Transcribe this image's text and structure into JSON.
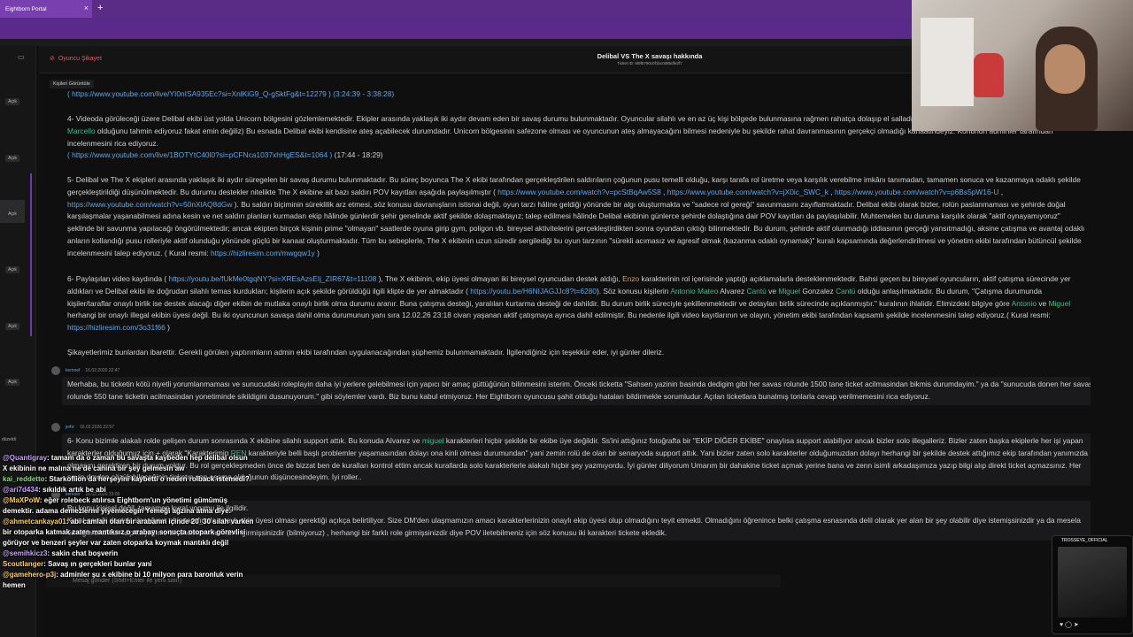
{
  "browser": {
    "tab_title": "Eightborn Portal",
    "tab_close": "×",
    "new_tab": "+"
  },
  "rail": {
    "items": [
      "Açık",
      "Açık",
      "Açık",
      "Açık",
      "Açık",
      "Açık"
    ],
    "footer": "düzeldi"
  },
  "ticket": {
    "back_label": "Oyuncu Şikayet",
    "title": "Delibal VS The X savaşı hakkında",
    "id": "Ticket ID: 6f9f5790c0f1bc0d8bdfe2f7",
    "section_label": "Kişileri Görüntüle"
  },
  "content": {
    "p_link_top": "( https://www.youtube.com/live/YI0nISA935Ec?si=XnlKiG9_Q-gSktFg&t=12279 ) (3:24:39 - 3:38:28)",
    "p4": "4- Videoda görüleceği üzere Delibal ekibi üst yolda Unicorn bölgesini gözlemlemektedir. Ekipler arasında yaklaşık iki aydır devam eden bir savaş durumu bulunmaktadır. Oyuncular silahlı ve en az üç kişi bölgede bulunmasına rağmen rahatça dolaşıp el salladığı görülmektedir.(Anlayabildiğimiz kadarıyla",
    "p4_name": "Marcello",
    "p4b": "olduğunu tahmin ediyoruz fakat emin değiliz) Bu esnada Delibal ekibi kendisine ateş açabilecek durumdadır. Unicorn bölgesinin safezone olması ve oyuncunun ateş almayacağını bilmesi nedeniyle bu şekilde rahat davranmasının gerçekçi olmadığı kanaatindeyiz. Konunun adminler tarafından incelenmesini rica ediyoruz.",
    "p4_link": "( https://www.youtube.com/live/1BOTYtC40l0?si=pCFNca1037xhHgES&t=1064 )",
    "p4_time": "(17:44 - 18:29)",
    "p5": "5- Delibal ve The X ekipleri arasında yaklaşık iki aydır süregelen bir savaş durumu bulunmaktadır. Bu süreç boyunca The X ekibi tarafından gerçekleştirilen saldırıların çoğunun pusu temelli olduğu, karşı tarafa rol üretme veya karşılık verebilme imkânı tanımadan, tamamen sonuca ve kazanmaya odaklı şekilde gerçekleştirildiği düşünülmektedir. Bu durumu destekler nitelikte The X ekibine ait bazı saldırı POV kayıtları aşağıda paylaşılmıştır (",
    "p5_link1": "https://www.youtube.com/watch?v=pcStBqAw5S8",
    "p5_link2": "https://www.youtube.com/watch?v=jX0ic_SWC_k",
    "p5_link3": "https://www.youtube.com/watch?v=p6Bs5pW16-U",
    "p5_link4": "https://www.youtube.com/watch?v=50nXlAQ8dGw",
    "p5b": "). Bu saldırı biçiminin süreklilik arz etmesi, söz konusu davranışların istisnai değil, oyun tarzı hâline geldiği yönünde bir algı oluşturmakta ve \"sadece rol gereği\" savunmasını zayıflatmaktadır. Delibal ekibi olarak bizler, rolün paslanmaması ve şehirde doğal karşılaşmalar yaşanabilmesi adına kesin ve net saldırı planları kurmadan ekip hâlinde günlerdir şehir genelinde aktif şekilde dolaşmaktayız; talep edilmesi hâlinde Delibal ekibinin günlerce şehirde dolaştığına dair POV kayıtları da paylaşılabilir. Muhtemelen bu duruma karşılık olarak \"aktif oynayamıyoruz\" şeklinde bir savunma yapılacağı öngörülmektedir; ancak ekipten birçok kişinin prime \"olmayan\" saatlerde oyuna girip gym, poligon vb. bireysel aktivitelerini gerçekleştirdikten sonra oyundan çıktığı bilinmektedir. Bu durum, şehirde aktif olunmadığı iddiasının gerçeği yansıtmadığı, aksine çatışma ve avantaj odaklı anların kollandığı pusu rolleriyle aktif olunduğu yönünde güçlü bir kanaat oluşturmaktadır. Tüm bu sebeplerle, The X ekibinin uzun süredir sergilediği bu oyun tarzının \"sürekli acımasız ve agresif olmak (kazanma odaklı oynamak)\" kuralı kapsamında değerlendirilmesi ve yönetim ekibi tarafından bütüncül şekilde incelenmesini talep ediyoruz. ( Kural resmi:",
    "p5_rule": "https://hizliresim.com/mwgqw1y",
    "p6a": "6- Paylaşılan video kaydında (",
    "p6_link1": "https://youtu.be/fUkMe0tgqNY?si=XREsAzsEIj_ZIR67&t=11108",
    "p6b": "), The X ekibinin, ekip üyesi olmayan iki bireysel oyuncudan destek aldığı,",
    "p6_enzo": "Enzo",
    "p6c": "karakterinin rol içerisinde yaptığı açıklamalarla desteklenmektedir. Bahsi geçen bu bireysel oyuncuların, aktif çatışma sürecinde yer aldıkları ve Delibal ekibi ile doğrudan silahlı temas kurdukları; kişilerin açık şekilde görüldüğü ilgili klipte de yer almaktadır (",
    "p6_link2": "https://youtu.be/H6NIJAGJJc8?t=6280",
    "p6d": "). Söz konusu kişilerin",
    "p6_n1": "Antonio Mateo",
    "p6_alv": "Alvarez",
    "p6_n2": "Cantú",
    "p6_ve": "ve",
    "p6_n3": "Miguel",
    "p6_gon": "Gonzalez",
    "p6_n4": "Cantú",
    "p6e": "olduğu anlaşılmaktadır. Bu durum, \"Çatışma durumunda kişiler/taraflar onaylı birlik ise destek alacağı diğer ekibin de mutlaka onaylı birlik olma durumu aranır. Buna çatışma desteği, yaralıları kurtarma desteği de dahildir. Bu durum birlik süreciyle şekillenmektedir ve detayları birlik sürecinde açıklanmıştır.\" kuralının ihlalidir. Elimizdeki bilgiye göre",
    "p6_n5": "Antonio",
    "p6_ve2": "ve",
    "p6_n6": "Miguel",
    "p6f": "herhangi bir onaylı illegal ekibin üyesi değil. Bu iki oyuncunun savaşa dahil olma durumunun yanı sıra 12.02.26 23:18 civarı yaşanan aktif çatışmaya ayrıca dahil edilmiştir. Bu nedenle ilgili video kayıtlarının ve olayın, yönetim ekibi tarafından kapsamlı şekilde incelenmesini talep ediyoruz.( Kural resmi:",
    "p6_rule": "https://hizliresim.com/3o31f66",
    "p6_end": ")",
    "closing": "Şikayetlerimiz bunlardan ibarettir. Gerekli görülen yaptırımların admin ekibi tarafından uygulanacağından şüphemiz bulunmamaktadır. İlgilendiğiniz için teşekkür eder, iyi günler dileriz.",
    "msg1_user": "kemoef",
    "msg1_time": "16.02.2026 22:47",
    "msg1": "Merhaba, bu ticketin kötü niyetli yorumlanmaması ve sunucudaki roleplayin daha iyi yerlere gelebilmesi için yapıcı bir amaç güttüğünün bilinmesini isterim. Önceki ticketta \"Sahsen yazinin basinda dedigim gibi her savas rolunde 1500 tane ticket acilmasindan bikmis durumdayim.\" ya da \"sunucuda donen her savas rolunde 550 tane ticketin acilmasindan yonetiminde sikildigini dusunuyorum.\" gibi söylemler vardı. Biz bunu kabul etmiyoruz. Her Eightborn oyuncusu şahit olduğu hataları bildirmekle sorumludur. Açılan ticketlara bunalmış tonlarla cevap verilmemesini rica ediyoruz.",
    "msg2_user": "je4rr",
    "msg2_time": "16.02.2026 22:57",
    "msg2a": "6- Konu bizimle alakalı rolde gelişen durum sonrasında X ekibine silahlı support attık. Bu konuda Alvarez ve",
    "msg2_n1": "miguel",
    "msg2b": "karakterleri hiçbir şekilde bir ekibe üye değildir. Ss'ini attığınız fotoğrafta bir \"EKİP DİĞER EKİBE\" onaylısa support atabiliyor ancak bizler solo illegalleriz. Bizler zaten başka ekiplerle her işi yapan karakterler olduğumuz için + olarak \"Karakterimin",
    "msg2_n2": "REN",
    "msg2c": "karakteriyle belli başlı problemler yaşamasından dolayı ona kinli olması durumundan\" yani zemin rolü de olan bir senaryoda support attık. Yani bizler zaten solo karakterler olduğumuzdan dolayı herhangi bir şekilde destek attığımız ekip tarafından yanımızda olmasını gerektiren bir durum yoktur. Bu rol gerçekleşmeden önce de bizzat ben de kuralları kontrol ettim ancak kurallarda solo karakterlerle alakalı hiçbir şey yazmıyordu. İyi günler diliyorum Umarım bir dahakine ticket açmak yerine bana ve zenn isimli arkadaşımıza yazıp bilgi alıp direkt ticket açmazsınız. Her şeyin dmden çözülebileceğinin ticketın son aşama olduğunun düşüncesindeyim. İyi roller..",
    "msg3_user": "kemoef",
    "msg3_time": "16.02.2026 23:05",
    "msg3a": "Bu konu kişisel değil, tamamen kural yorumu ile ilgilidir.",
    "msg3b": "Kural gereği destek alacağınız ekip tarafın da onaylı ekip üyesi olması gerektiği açıkça belirtiliyor. Size DM'den ulaşmamızın amacı karakterlerinizin onaylı ekip üyesi olup olmadığını teyit etmekti. Olmadığını öğrenince belki çatışma esnasında delil olarak yer alan bir şey olabilir diye istemişsinizdir ya da mesela örneğin silahları alıp kaçtığınız bir dolandırma rolüne girmişsinizdir (bilmiyoruz) , herhangi bir farklı role girmişsinizdir diye POV iletebilmeniz için söz konusu iki karakteri tickete ekledik."
  },
  "input": {
    "placeholder": "Mesaj gönder (Shift+Enter ile yeni satır)"
  },
  "chat": [
    {
      "user": "@Quantigray",
      "text": ": tamam da o zaman bu savaşta kaybeden hep delibal olsun"
    },
    {
      "user": "",
      "text": "X ekibinin ne malına ne de canına bir şey gelmesin aw"
    },
    {
      "user": "kai_reddetto",
      "text": ": Starkoflion da herşeyini kaybetti o neden rolback istemedi?"
    },
    {
      "user": "@ari7d434",
      "text": ": sıkıldık artık be abi"
    },
    {
      "user": "@MaXPoW",
      "text": ": eğer rolebeck atılırsa Eightborn'un yönetimi gümümüş demektir. adama demezlermi yiyemecegin Yemeği ağzına atma diye."
    },
    {
      "user": "@ahmetcankaya01",
      "text": ": abi camları olan bir arabanın içinde 20_30 silah varken bir otoparka katmak zaten mantıksız o arabayı sonuçta otopark görevlisi görüyor ve benzeri şeyler var zaten otoparka koymak mantıklı değil"
    },
    {
      "user": "@semihkicz3",
      "text": ": sakin chat boşverin"
    },
    {
      "user": "Scoutlanger",
      "text": ": Savaş ın gerçekleri bunlar yani"
    },
    {
      "user": "@gamehero-p3j",
      "text": ": adminler şu x ekibine bi 10 milyon para baronluk verin hemen"
    }
  ],
  "insta": {
    "name": "TROSSEYE_OFFICIAL",
    "actions": "♥ ◯ ➤"
  }
}
